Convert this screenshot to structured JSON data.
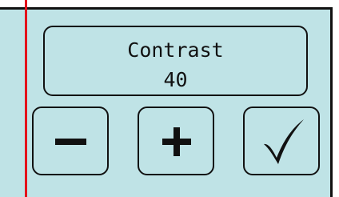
{
  "setting": {
    "label": "Contrast",
    "value": "40"
  },
  "buttons": {
    "decrease": "minus-icon",
    "increase": "plus-icon",
    "confirm": "checkmark-icon"
  },
  "colors": {
    "screen_background": "#bfe3e6",
    "accent_line": "#e3121b",
    "foreground": "#111111"
  }
}
